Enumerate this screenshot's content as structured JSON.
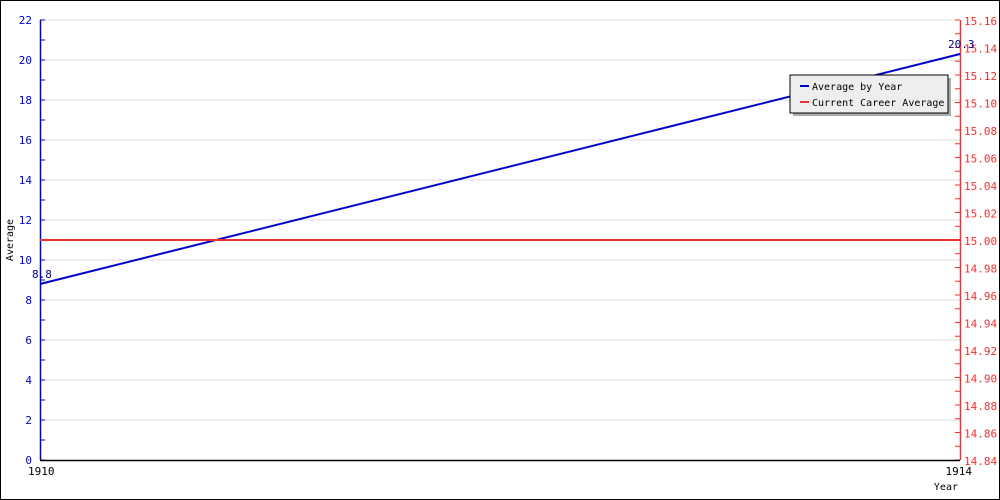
{
  "chart_data": {
    "type": "line",
    "title": "",
    "xlabel": "Year",
    "ylabel": "Average",
    "y2label": "",
    "x": [
      1910,
      1914
    ],
    "x_tick_labels": [
      "1910",
      "1914"
    ],
    "xlim": [
      1910,
      1914
    ],
    "ylim": [
      0,
      22
    ],
    "y_ticks": [
      0,
      2,
      4,
      6,
      8,
      10,
      12,
      14,
      16,
      18,
      20,
      22
    ],
    "y2lim": [
      14.84,
      15.16
    ],
    "y2_ticks": [
      "14.84",
      "14.86",
      "14.88",
      "14.90",
      "14.92",
      "14.94",
      "14.96",
      "14.98",
      "15.00",
      "15.02",
      "15.04",
      "15.06",
      "15.08",
      "15.10",
      "15.12",
      "15.14",
      "15.16"
    ],
    "grid": true,
    "legend_position": "top-right",
    "series": [
      {
        "name": "Average by Year",
        "axis": "left",
        "color": "#0000cc",
        "x": [
          1910,
          1914
        ],
        "values": [
          8.8,
          20.3
        ],
        "data_labels": [
          "8.8",
          "20.3"
        ]
      },
      {
        "name": "Current Career Average",
        "axis": "right",
        "color": "#ee3333",
        "x": [
          1910,
          1914
        ],
        "values": [
          15.0,
          15.0
        ]
      }
    ]
  },
  "colors": {
    "left_axis": "#0000cc",
    "right_axis": "#ee3333",
    "grid": "#dddddd"
  }
}
